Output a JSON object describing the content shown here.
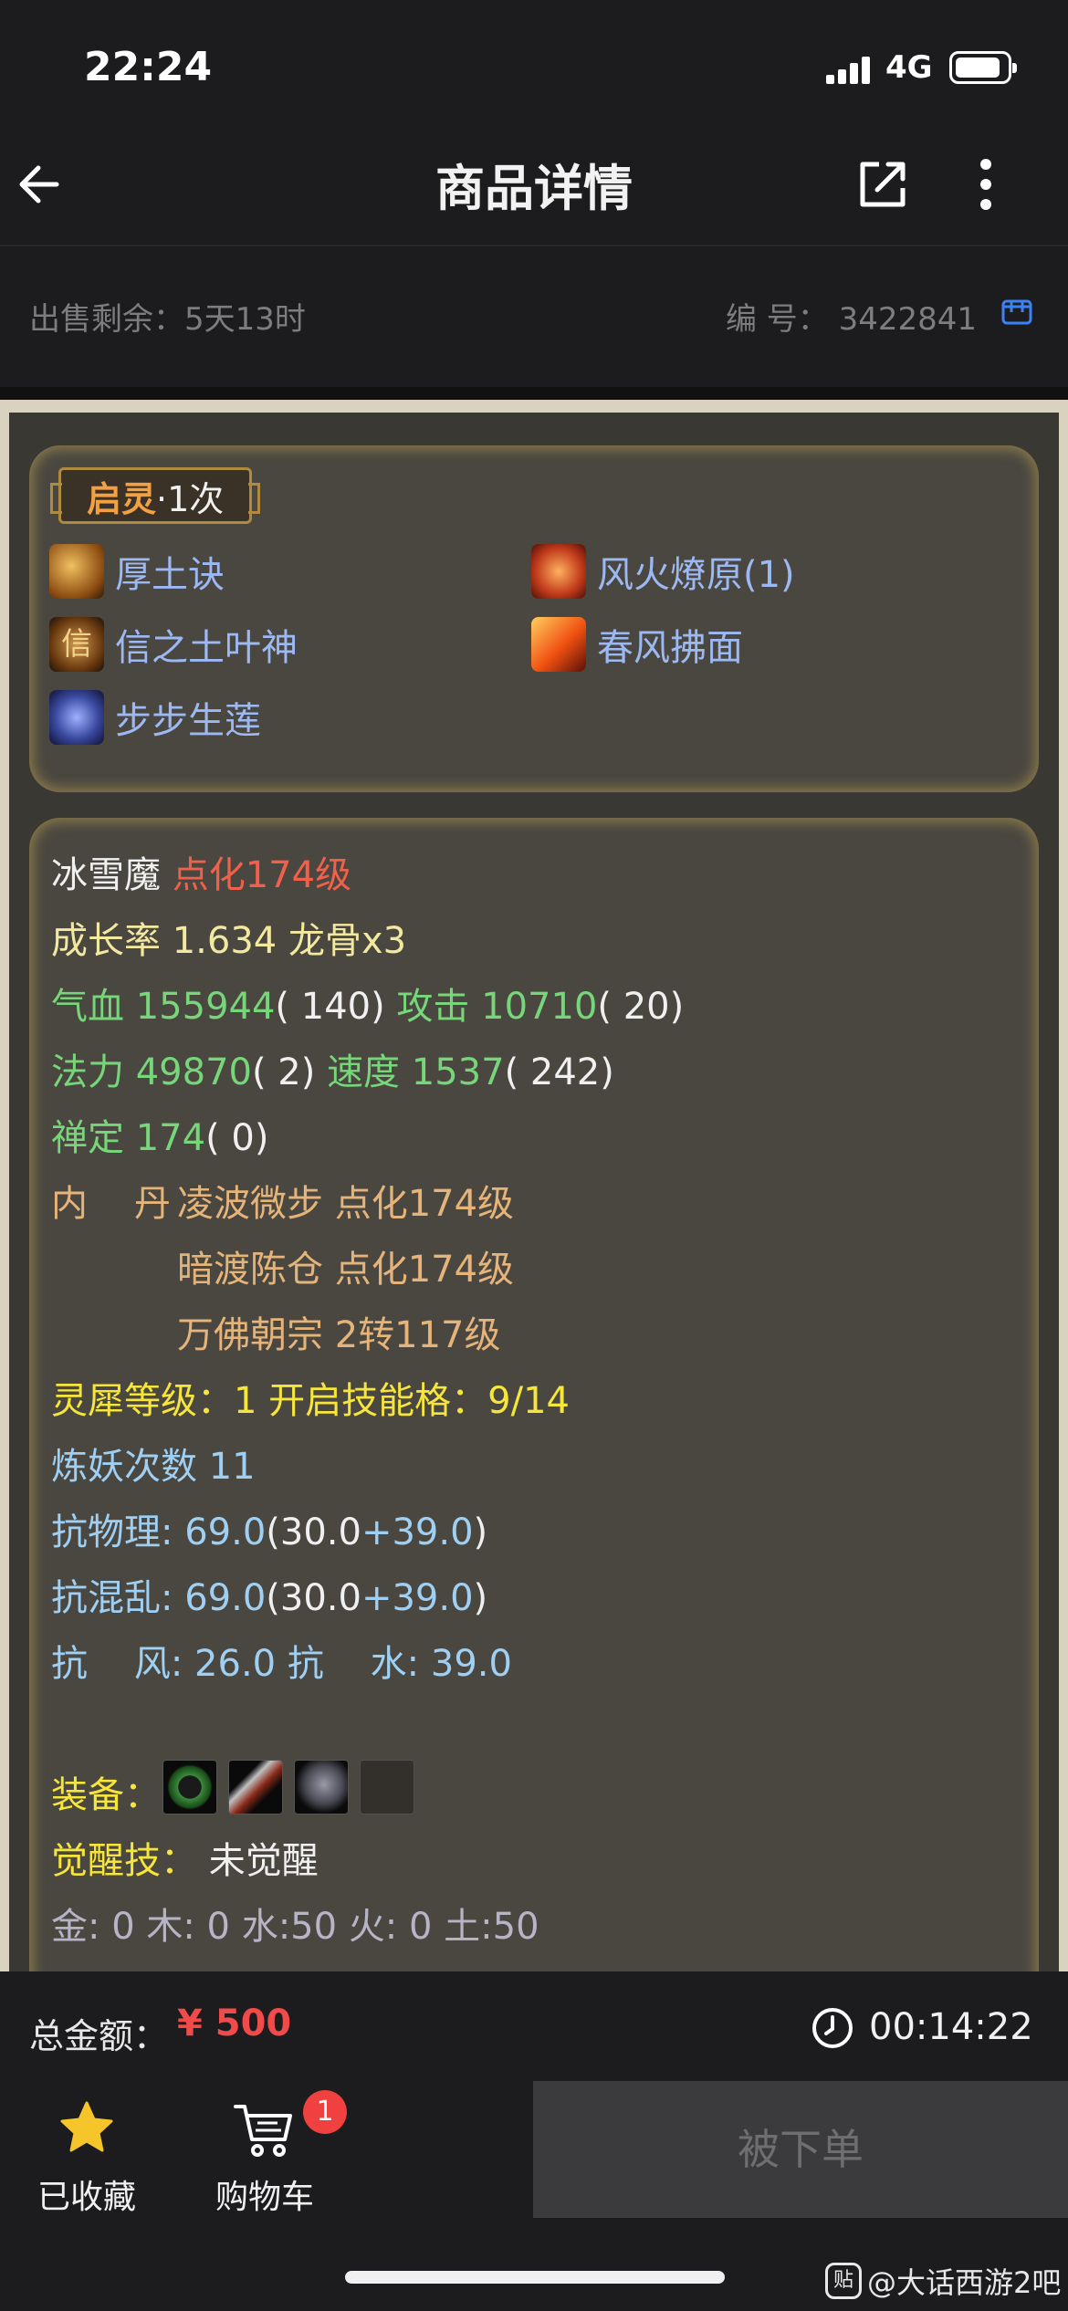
{
  "status_bar": {
    "time": "22:24",
    "network": "4G",
    "battery_level": 0.85
  },
  "nav": {
    "title": "商品详情"
  },
  "info": {
    "sale_remaining": "出售剩余：5天13时",
    "serial": "编  号：  3422841"
  },
  "qiling": {
    "label": "启灵",
    "count": "·1次"
  },
  "skills": [
    {
      "name": "厚土诀",
      "icon": "earth-skill-icon",
      "color": "#c07a20"
    },
    {
      "name": "风火燎原(1)",
      "icon": "fire-wind-skill-icon",
      "color": "#d0502a"
    },
    {
      "name": "信之土叶神",
      "icon": "xin-skill-icon",
      "color": "#8a5a20"
    },
    {
      "name": "春风拂面",
      "icon": "spring-wind-skill-icon",
      "color": "#e0601a"
    },
    {
      "name": "步步生莲",
      "icon": "lotus-skill-icon",
      "color": "#3a4a9a"
    }
  ],
  "pet": {
    "name": "冰雪魔",
    "level": "点化174级",
    "growth": "成长率 1.634 龙骨x3",
    "hp_label": "气血 ",
    "hp_value": "155944",
    "hp_extra": "( 140)",
    "atk_label": "攻击 ",
    "atk_value": "10710",
    "atk_extra": "( 20)",
    "mp_label": "法力 ",
    "mp_value": "49870",
    "mp_extra": "( 2)",
    "spd_label": "速度 ",
    "spd_value": "1537",
    "spd_extra": "( 242)",
    "zen_label": "禅定 ",
    "zen_value": "174",
    "zen_extra": "( 0)",
    "neidan_label": "内    丹",
    "neidan": [
      "凌波微步 点化174级",
      "暗渡陈仓 点化174级",
      "万佛朝宗 2转117级"
    ],
    "lingxi": "灵犀等级：1 开启技能格：9/14",
    "lianyao": "炼妖次数 11",
    "resist_phys_label": "抗物理: ",
    "resist_phys_value": "69.0",
    "resist_phys_base": "(30.0",
    "resist_phys_bonus": "+39.0",
    "resist_phys_close": ")",
    "resist_chaos_label": "抗混乱: ",
    "resist_chaos_value": "69.0",
    "resist_chaos_base": "(30.0",
    "resist_chaos_bonus": "+39.0",
    "resist_chaos_close": ")",
    "resist_wind_water": "抗    风: 26.0 抗    水: 39.0",
    "equip_label": "装备：",
    "equipment": [
      "ring-equipment-icon",
      "axe-equipment-icon",
      "armor-equipment-icon",
      "empty-equipment-slot"
    ],
    "awaken_label": "觉醒技：",
    "awaken_value": "未觉醒",
    "elements": "金: 0 木: 0 水:50 火: 0 土:50"
  },
  "total": {
    "label": "总金额：",
    "amount": "¥ 500",
    "timer": "00:14:22"
  },
  "actions": {
    "favorite": "已收藏",
    "cart": "购物车",
    "cart_count": "1",
    "order": "被下单"
  },
  "watermark": {
    "icon": "贴",
    "text": "@大话西游2吧"
  },
  "colors": {
    "accent_red": "#f04a4a",
    "link_blue": "#9db9f4",
    "star_yellow": "#f6c52a"
  }
}
